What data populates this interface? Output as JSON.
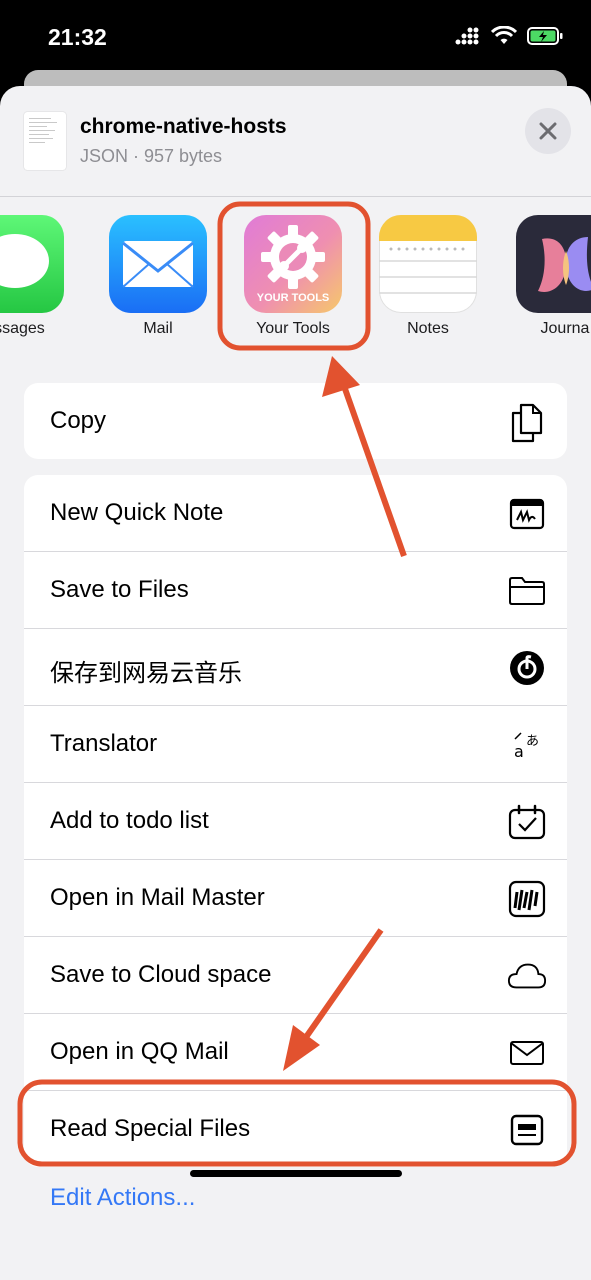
{
  "status_bar": {
    "time": "21:32"
  },
  "file": {
    "name": "chrome-native-hosts",
    "meta": "JSON · 957 bytes"
  },
  "apps": [
    {
      "label": "essages",
      "icon": "messages-icon"
    },
    {
      "label": "Mail",
      "icon": "mail-icon"
    },
    {
      "label": "Your Tools",
      "icon": "your-tools-icon",
      "icon_text": "YOUR TOOLS"
    },
    {
      "label": "Notes",
      "icon": "notes-icon"
    },
    {
      "label": "Journa",
      "icon": "journal-icon"
    }
  ],
  "actions_top": [
    {
      "label": "Copy",
      "icon": "copy-icon"
    }
  ],
  "actions": [
    {
      "label": "New Quick Note",
      "icon": "quick-note-icon"
    },
    {
      "label": "Save to Files",
      "icon": "folder-icon"
    },
    {
      "label": "保存到网易云音乐",
      "icon": "netease-music-icon"
    },
    {
      "label": "Translator",
      "icon": "translate-icon"
    },
    {
      "label": "Add to todo list",
      "icon": "calendar-check-icon"
    },
    {
      "label": "Open in Mail Master",
      "icon": "mail-master-icon"
    },
    {
      "label": "Save to Cloud space",
      "icon": "cloud-icon"
    },
    {
      "label": "Open in QQ Mail",
      "icon": "envelope-icon"
    },
    {
      "label": "Read Special Files",
      "icon": "read-file-icon"
    }
  ],
  "edit_actions": "Edit Actions...",
  "colors": {
    "accent": "#3478f6",
    "annotation": "#e2522f",
    "sheet_bg": "#f2f2f4"
  }
}
